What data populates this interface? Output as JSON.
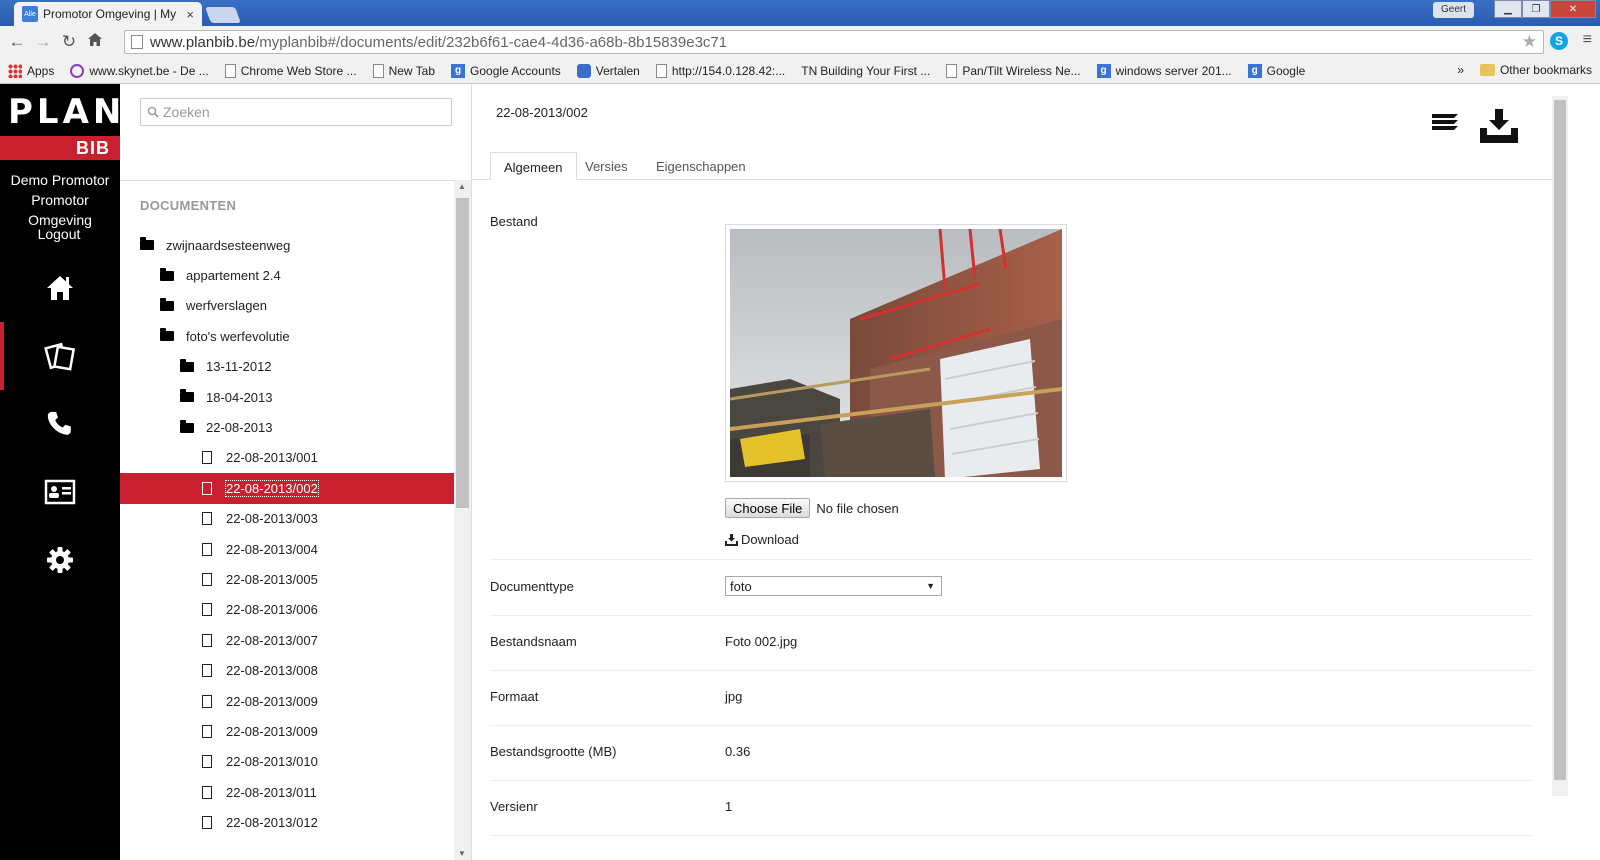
{
  "browser": {
    "tab_title": "Promotor Omgeving | My",
    "tab_close": "×",
    "favicon_text": "Alle",
    "user": "Geert",
    "url_host": "www.planbib.be",
    "url_path": "/myplanbib#/documents/edit/232b6f61-cae4-4d36-a68b-8b15839e3c71",
    "skype_letter": "S",
    "bookmarks": [
      {
        "label": "Apps",
        "kind": "apps"
      },
      {
        "label": "www.skynet.be - De ...",
        "kind": "purple"
      },
      {
        "label": "Chrome Web Store ...",
        "kind": "page"
      },
      {
        "label": "New Tab",
        "kind": "page"
      },
      {
        "label": "Google Accounts",
        "kind": "g"
      },
      {
        "label": "Vertalen",
        "kind": "trans"
      },
      {
        "label": "http://154.0.128.42:...",
        "kind": "page"
      },
      {
        "label": "Building Your First ...",
        "kind": "tn"
      },
      {
        "label": "Pan/Tilt Wireless Ne...",
        "kind": "page"
      },
      {
        "label": "windows server 201...",
        "kind": "g"
      },
      {
        "label": "Google",
        "kind": "g"
      }
    ],
    "bookmarks_more": "»",
    "other_bookmarks": "Other bookmarks",
    "tn_badge": "TN"
  },
  "sidebar": {
    "logo_top": "PLAN",
    "logo_bottom": "BIB",
    "user_line1": "Demo Promotor",
    "user_line2": "Promotor Omgeving",
    "logout": "Logout",
    "nav": [
      "home-icon",
      "documents-icon",
      "phone-icon",
      "contact-card-icon",
      "gear-icon"
    ]
  },
  "documents": {
    "search_placeholder": "Zoeken",
    "heading": "DOCUMENTEN",
    "tree": [
      {
        "label": "zwijnaardsesteenweg",
        "type": "folder",
        "level": 0
      },
      {
        "label": "appartement 2.4",
        "type": "folder",
        "level": 1
      },
      {
        "label": "werfverslagen",
        "type": "folder",
        "level": 1
      },
      {
        "label": "foto's werfevolutie",
        "type": "folder",
        "level": 1
      },
      {
        "label": "13-11-2012",
        "type": "folder",
        "level": 2
      },
      {
        "label": "18-04-2013",
        "type": "folder",
        "level": 2
      },
      {
        "label": "22-08-2013",
        "type": "folder",
        "level": 2
      },
      {
        "label": "22-08-2013/001",
        "type": "file",
        "level": 3
      },
      {
        "label": "22-08-2013/002",
        "type": "file",
        "level": 3,
        "selected": true
      },
      {
        "label": "22-08-2013/003",
        "type": "file",
        "level": 3
      },
      {
        "label": "22-08-2013/004",
        "type": "file",
        "level": 3
      },
      {
        "label": "22-08-2013/005",
        "type": "file",
        "level": 3
      },
      {
        "label": "22-08-2013/006",
        "type": "file",
        "level": 3
      },
      {
        "label": "22-08-2013/007",
        "type": "file",
        "level": 3
      },
      {
        "label": "22-08-2013/008",
        "type": "file",
        "level": 3
      },
      {
        "label": "22-08-2013/009",
        "type": "file",
        "level": 3
      },
      {
        "label": "22-08-2013/009",
        "type": "file",
        "level": 3
      },
      {
        "label": "22-08-2013/010",
        "type": "file",
        "level": 3
      },
      {
        "label": "22-08-2013/011",
        "type": "file",
        "level": 3
      },
      {
        "label": "22-08-2013/012",
        "type": "file",
        "level": 3
      }
    ]
  },
  "detail": {
    "title": "22-08-2013/002",
    "tabs": [
      "Algemeen",
      "Versies",
      "Eigenschappen"
    ],
    "active_tab": 0,
    "bestand_label": "Bestand",
    "choose_file": "Choose File",
    "no_file": "No file chosen",
    "download": "Download",
    "documenttype_label": "Documenttype",
    "documenttype_value": "foto",
    "bestandsnaam_label": "Bestandsnaam",
    "bestandsnaam_value": "Foto 002.jpg",
    "formaat_label": "Formaat",
    "formaat_value": "jpg",
    "grootte_label": "Bestandsgrootte (MB)",
    "grootte_value": "0.36",
    "versienr_label": "Versienr",
    "versienr_value": "1"
  },
  "colors": {
    "brand_red": "#c8202f",
    "sidebar_bg": "#000000"
  }
}
